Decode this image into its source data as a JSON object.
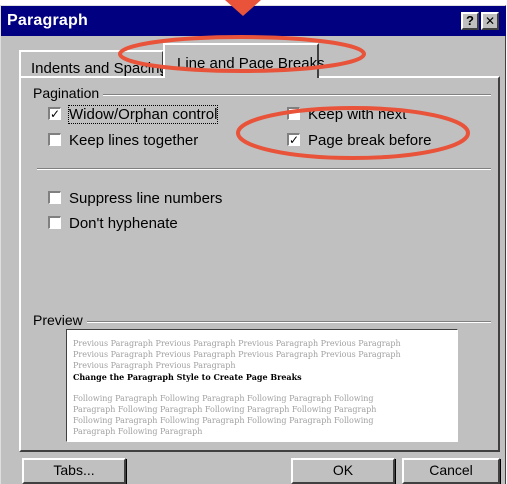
{
  "window": {
    "title": "Paragraph",
    "help_glyph": "?",
    "close_glyph": "✕"
  },
  "tabs": [
    {
      "label": "Indents and Spacing",
      "active": false
    },
    {
      "label": "Line and Page Breaks",
      "active": true
    }
  ],
  "pagination": {
    "group_label": "Pagination",
    "options": [
      {
        "label": "Widow/Orphan control",
        "checked": true
      },
      {
        "label": "Keep with next",
        "checked": false
      },
      {
        "label": "Keep lines together",
        "checked": false
      },
      {
        "label": "Page break before",
        "checked": true
      }
    ]
  },
  "other_options": [
    {
      "label": "Suppress line numbers",
      "checked": false
    },
    {
      "label": "Don't hyphenate",
      "checked": false
    }
  ],
  "preview": {
    "group_label": "Preview",
    "previous_lines": [
      "Previous Paragraph Previous Paragraph Previous Paragraph Previous Paragraph",
      "Previous Paragraph Previous Paragraph Previous Paragraph Previous Paragraph",
      "Previous Paragraph Previous Paragraph"
    ],
    "current_line": "Change the Paragraph Style to Create Page Breaks",
    "following_lines": [
      "Following Paragraph Following Paragraph Following Paragraph Following",
      "Paragraph Following Paragraph Following Paragraph Following Paragraph",
      "Following Paragraph Following Paragraph Following Paragraph Following",
      "Paragraph Following Paragraph"
    ]
  },
  "buttons": {
    "tabs": "Tabs...",
    "ok": "OK",
    "cancel": "Cancel"
  },
  "annotation_color": "#e8533a"
}
